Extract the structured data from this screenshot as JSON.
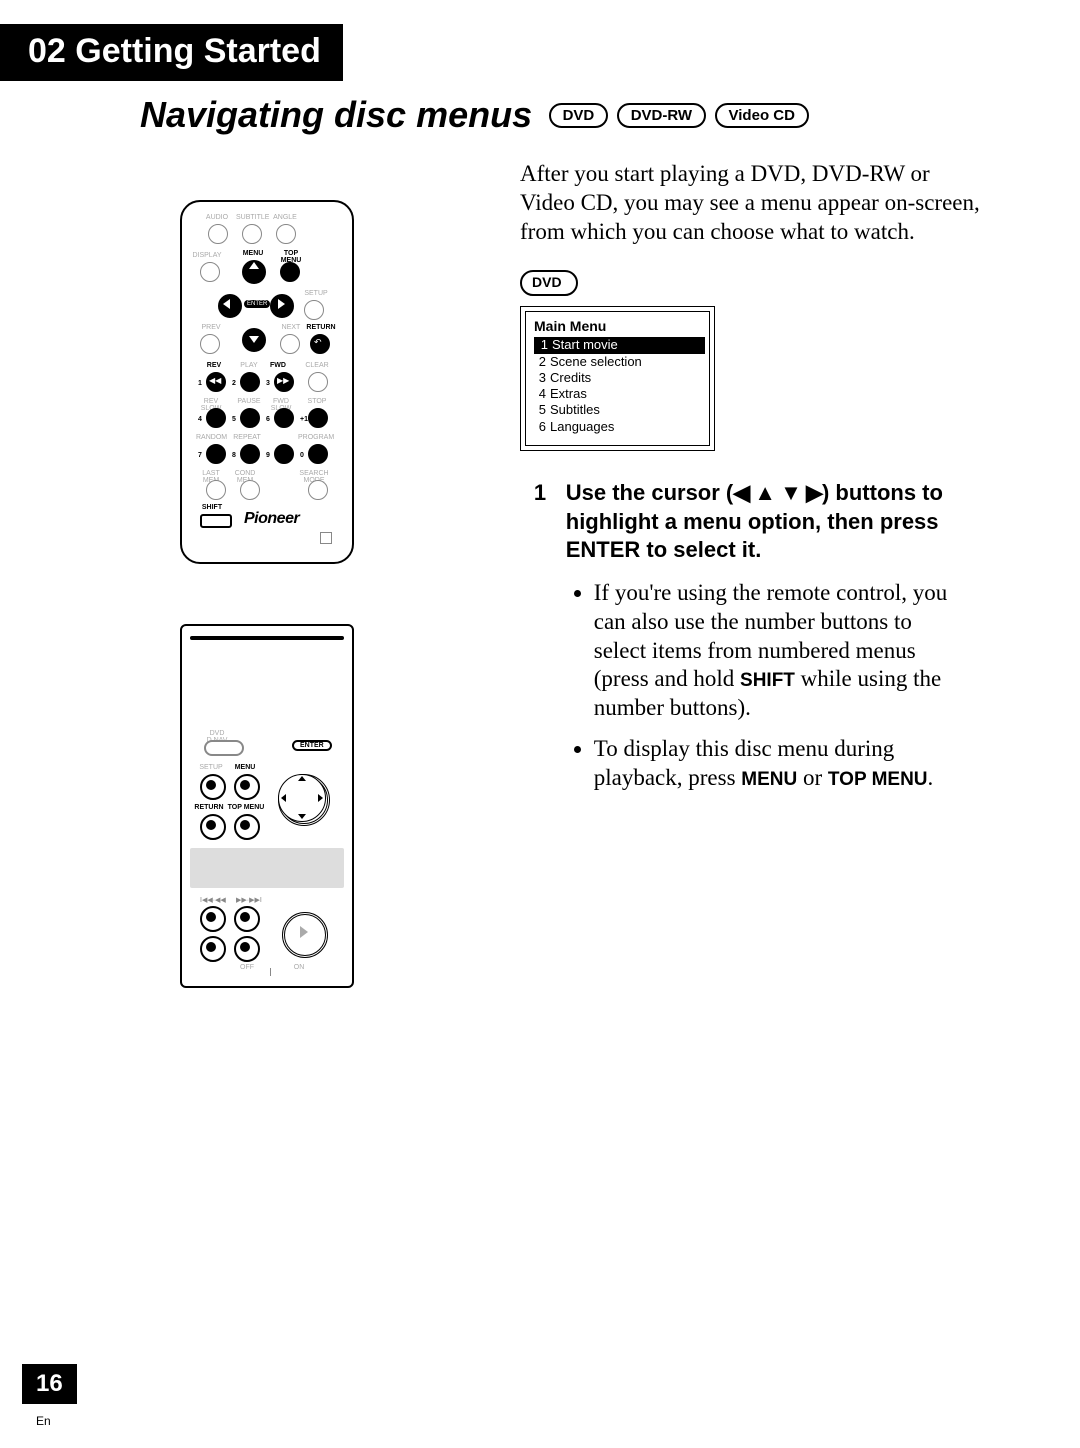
{
  "chapter": {
    "label": "02 Getting Started"
  },
  "section": {
    "title": "Navigating disc menus",
    "badges": [
      "DVD",
      "DVD-RW",
      "Video CD"
    ]
  },
  "intro": "After you start playing a DVD, DVD-RW or Video CD,  you may see a menu appear on-screen, from which you can choose what to watch.",
  "dvd_pill": "DVD",
  "main_menu": {
    "title": "Main Menu",
    "items": [
      {
        "n": "1",
        "label": "Start movie",
        "selected": true
      },
      {
        "n": "2",
        "label": "Scene selection",
        "selected": false
      },
      {
        "n": "3",
        "label": "Credits",
        "selected": false
      },
      {
        "n": "4",
        "label": "Extras",
        "selected": false
      },
      {
        "n": "5",
        "label": "Subtitles",
        "selected": false
      },
      {
        "n": "6",
        "label": "Languages",
        "selected": false
      }
    ]
  },
  "step": {
    "num": "1",
    "head_a": "Use the cursor (",
    "head_arrows": "◀ ▲ ▼ ▶",
    "head_b": ") buttons to highlight a menu option, then press ENTER to select it.",
    "bullet1_a": "If you're using the remote control, you can also use the number buttons to select items from numbered menus (press and hold ",
    "bullet1_key": "SHIFT",
    "bullet1_b": " while using the number buttons).",
    "bullet2_a": "To display this disc menu during playback, press ",
    "bullet2_key1": "MENU",
    "bullet2_mid": " or ",
    "bullet2_key2": "TOP MENU",
    "bullet2_end": "."
  },
  "remote1": {
    "row0": [
      "AUDIO",
      "SUBTITLE",
      "ANGLE"
    ],
    "row1": [
      "DISPLAY",
      "MENU",
      "TOP MENU"
    ],
    "enter": "ENTER",
    "setup": "SETUP",
    "prev": "PREV",
    "next": "NEXT",
    "ret": "RETURN",
    "row3": [
      "REV",
      "PLAY",
      "FWD",
      "CLEAR"
    ],
    "row4": [
      "REV SLOW",
      "PAUSE",
      "FWD SLOW",
      "STOP"
    ],
    "row5": [
      "RANDOM",
      "REPEAT",
      "",
      "PROGRAM"
    ],
    "row6": [
      "LAST MEM",
      "COND MEM",
      "",
      "SEARCH MODE"
    ],
    "nums": [
      "1",
      "2",
      "3",
      "4",
      "5",
      "6",
      "+10",
      "7",
      "8",
      "9",
      "0"
    ],
    "shift": "SHIFT",
    "brand": "Pioneer"
  },
  "remote2": {
    "dvd": "DVD D.NAV",
    "enter": "ENTER",
    "setup": "SETUP",
    "menu": "MENU",
    "ret": "RETURN",
    "topmenu": "TOP MENU",
    "off": "OFF",
    "on": "ON"
  },
  "page": {
    "num": "16",
    "lang": "En"
  }
}
